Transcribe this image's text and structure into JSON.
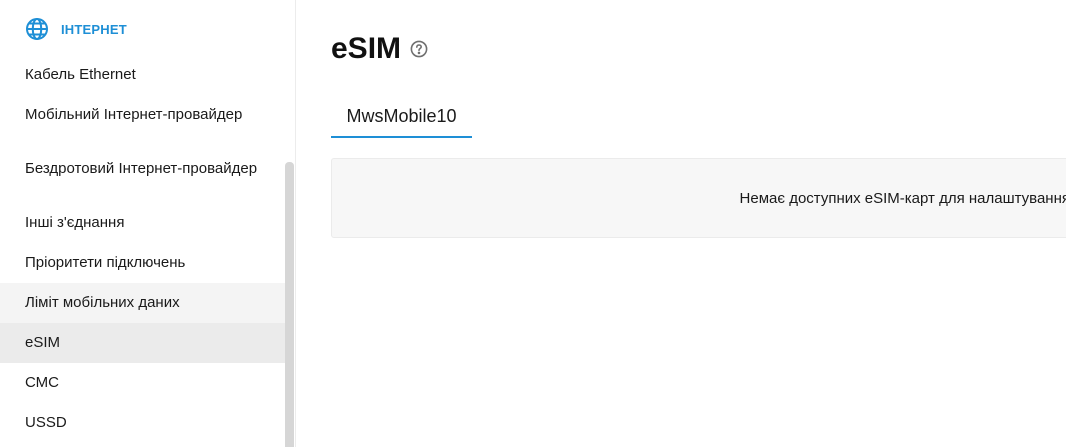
{
  "sidebar": {
    "section_title": "ІНТЕРНЕТ",
    "section_icon": "globe-icon",
    "accent_color": "#1e8fd6",
    "items": [
      {
        "label": "Кабель Ethernet"
      },
      {
        "label": "Мобільний Інтернет-провайдер"
      },
      {
        "label": "Бездротовий Інтернет-провайдер"
      },
      {
        "label": "Інші з'єднання"
      },
      {
        "label": "Пріоритети підключень"
      },
      {
        "label": "Ліміт мобільних даних"
      },
      {
        "label": "eSIM"
      },
      {
        "label": "СМС"
      },
      {
        "label": "USSD"
      }
    ],
    "active_item": "eSIM"
  },
  "main": {
    "title": "eSIM",
    "help_icon": "help-circle-icon",
    "tabs": [
      {
        "label": "MwsMobile10"
      }
    ],
    "active_tab": "MwsMobile10",
    "empty_message": "Немає доступних eSIM-карт для налаштування"
  }
}
